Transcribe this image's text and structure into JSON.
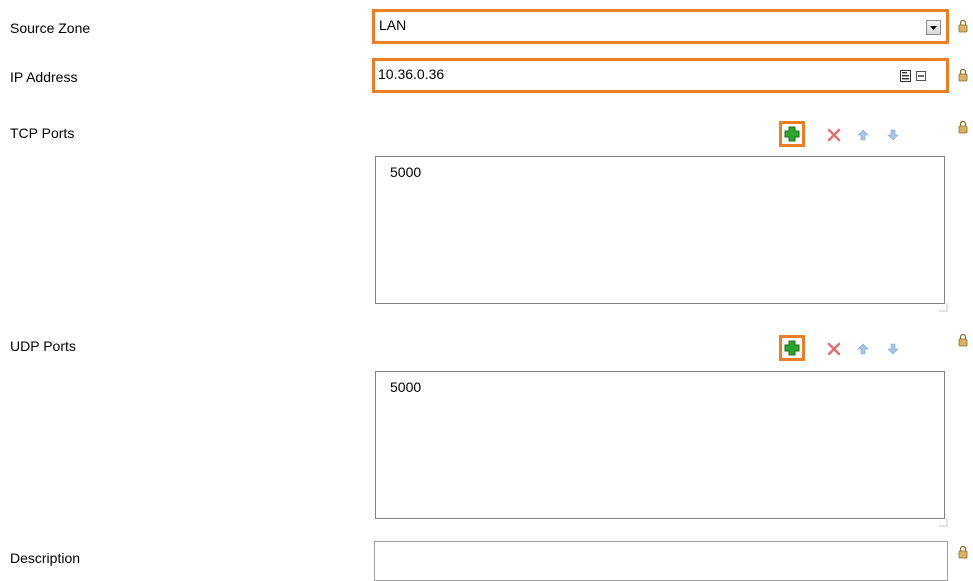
{
  "form": {
    "source_zone": {
      "label": "Source Zone",
      "value": "LAN"
    },
    "ip_address": {
      "label": "IP Address",
      "value": "10.36.0.36"
    },
    "tcp_ports": {
      "label": "TCP Ports",
      "items": [
        "5000"
      ]
    },
    "udp_ports": {
      "label": "UDP Ports",
      "items": [
        "5000"
      ]
    },
    "description": {
      "label": "Description",
      "value": ""
    }
  },
  "icons": {
    "lock": "lock-icon",
    "add": "add-icon",
    "remove": "remove-icon",
    "move_up": "arrow-up-icon",
    "move_down": "arrow-down-icon",
    "dropdown": "chevron-down-icon",
    "list_picker": "list-picker-icon",
    "clear": "clear-icon"
  },
  "colors": {
    "highlight": "#ef7d22",
    "add_green": "#2aa62a",
    "remove_red": "#e07070",
    "arrow_blue": "#a9c4e6",
    "lock_gold": "#b48a3a"
  }
}
